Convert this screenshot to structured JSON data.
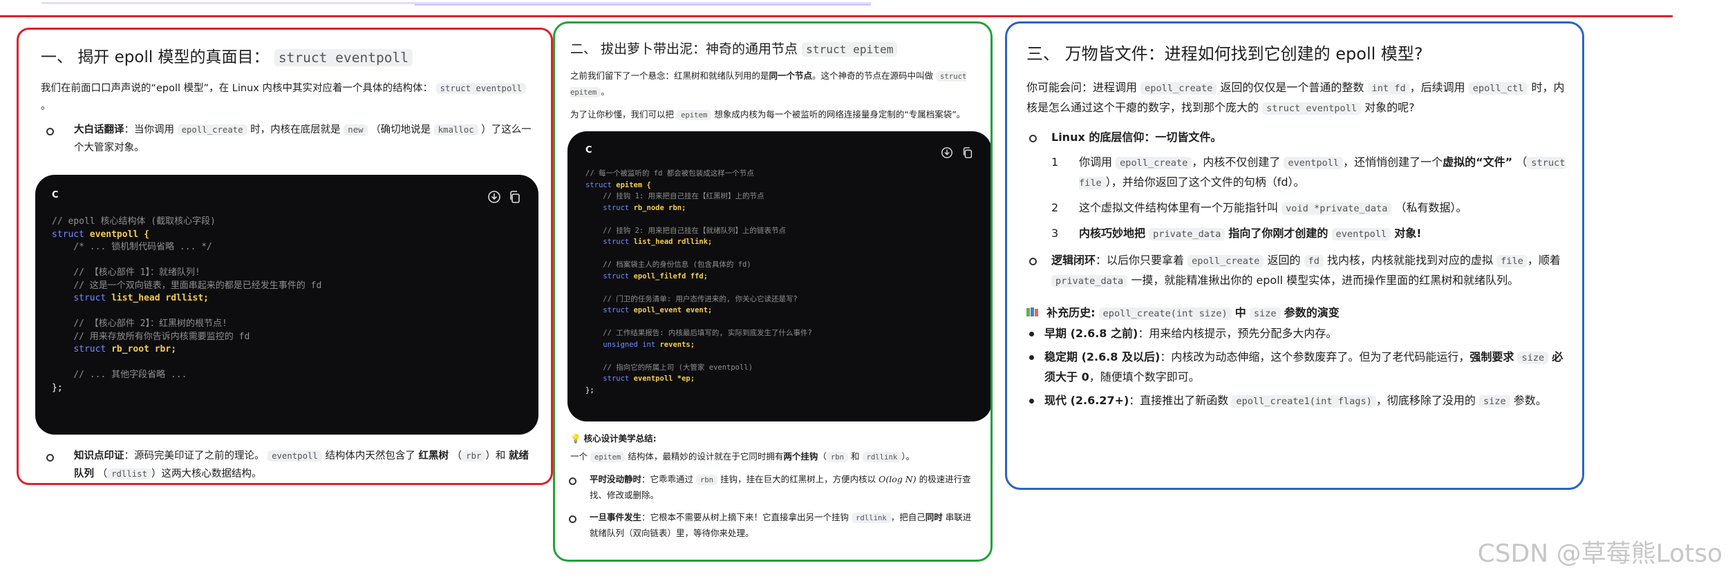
{
  "card1": {
    "title": "一、 揭开 epoll 模型的真面目：",
    "title_code": "struct eventpoll",
    "intro_a": "我们在前面口口声声说的“epoll 模型”，在 Linux 内核中其实对应着一个具体的结构体：",
    "intro_code": "struct eventpoll",
    "intro_b": "。",
    "bullet1_label": "大白话翻译",
    "bullet1_a": "：当你调用",
    "bullet1_code1": "epoll_create",
    "bullet1_b": "时，内核在底层就是",
    "bullet1_code2": "new",
    "bullet1_c": "（确切地说是",
    "bullet1_code3": "kmalloc",
    "bullet1_d": "）了这么一个大管家对象。",
    "code_lang": "C",
    "code_lines": [
      "// epoll 核心结构体 (截取核心字段)",
      "struct eventpoll {",
      "    /* ... 锁机制代码省略 ... */",
      "",
      "    // 【核心部件 1】：就绪队列!",
      "    // 这是一个双向链表，里面串起来的都是已经发生事件的 fd",
      "    struct list_head rdllist;",
      "",
      "    // 【核心部件 2】：红黑树的根节点!",
      "    // 用来存放所有你告诉内核需要监控的 fd",
      "    struct rb_root rbr;",
      "",
      "    // ... 其他字段省略 ...",
      "};"
    ],
    "bullet2_label": "知识点印证",
    "bullet2_a": "：源码完美印证了之前的理论。",
    "bullet2_code1": "eventpoll",
    "bullet2_b": "结构体内天然包含了",
    "bullet2_bold1": "红黑树",
    "bullet2_c": "（",
    "bullet2_code2": "rbr",
    "bullet2_d": "）和",
    "bullet2_bold2": "就绪队列",
    "bullet2_e": "（",
    "bullet2_code3": "rdllist",
    "bullet2_f": "）这两大核心数据结构。"
  },
  "card2": {
    "title": "二、 拔出萝卜带出泥：神奇的通用节点",
    "title_code": "struct epitem",
    "p1_a": "之前我们留下了一个悬念：红黑树和就绪队列用的是",
    "p1_bold": "同一个节点",
    "p1_b": "。这个神奇的节点在源码中叫做",
    "p1_code": "struct epitem",
    "p1_c": "。",
    "p2_a": "为了让你秒懂，我们可以把",
    "p2_code": "epitem",
    "p2_b": "想象成内核为每一个被监听的网络连接量身定制的“专属档案袋”。",
    "code_lang": "C",
    "code_lines": [
      "// 每一个被监听的 fd 都会被包装成这样一个节点",
      "struct epitem {",
      "    // 挂钩 1: 用来把自己挂在【红黑树】上的节点",
      "    struct rb_node rbn;",
      "",
      "    // 挂钩 2: 用来把自己挂在【就绪队列】上的链表节点",
      "    struct list_head rdllink;",
      "",
      "    // 档案袋主人的身份信息 (包含具体的 fd)",
      "    struct epoll_filefd ffd;",
      "",
      "    // 门卫的任务清单: 用户态传进来的, 你关心它读还是写?",
      "    struct epoll_event event;",
      "",
      "    // 工作结果报告: 内核最后填写的, 实际到底发生了什么事件?",
      "    unsigned int revents;",
      "",
      "    // 指向它的所属上司 (大管家 eventpoll)",
      "    struct eventpoll *ep;",
      "};"
    ],
    "summary_icon": "lightbulb-icon",
    "summary_title": "核心设计美学总结:",
    "summary_a": "一个",
    "summary_code1": "epitem",
    "summary_b": "结构体，最精妙的设计就在于它同时拥有",
    "summary_bold": "两个挂钩",
    "summary_c": "（",
    "summary_code2": "rbn",
    "summary_d": "和",
    "summary_code3": "rdllink",
    "summary_e": "）。",
    "b1_label": "平时没动静时",
    "b1_a": "：它乖乖通过",
    "b1_code": "rbn",
    "b1_b": "挂钩，挂在巨大的红黑树上，方便内核以",
    "b1_math": "O(log N)",
    "b1_c": "的极速进行查找、修改或删除。",
    "b2_label": "一旦事件发生",
    "b2_a": "：它根本不需要从树上摘下来！它直接拿出另一个挂钩",
    "b2_code": "rdllink",
    "b2_b": "，把自己",
    "b2_bold": "同时",
    "b2_c": "串联进就绪队列（双向链表）里，等待你来处理。"
  },
  "card3": {
    "title": "三、 万物皆文件：进程如何找到它创建的 epoll 模型?",
    "p1_a": "你可能会问：进程调用",
    "p1_code1": "epoll_create",
    "p1_b": "返回的仅仅是一个普通的整数",
    "p1_code2": "int fd",
    "p1_c": "，后续调用",
    "p1_code3": "epoll_ctl",
    "p1_d": "时，内核是怎么通过这个干瘪的数字，找到那个庞大的",
    "p1_code4": "struct eventpoll",
    "p1_e": "对象的呢?",
    "b1_label": "Linux 的底层信仰：一切皆文件。",
    "o1_n": "1",
    "o1_a": "你调用",
    "o1_code1": "epoll_create",
    "o1_b": "，内核不仅创建了",
    "o1_code2": "eventpoll",
    "o1_c": "，还悄悄创建了一个",
    "o1_bold": "虚拟的“文件”",
    "o1_d": "（",
    "o1_code3": "struct file",
    "o1_e": "），并给你返回了这个文件的句柄（fd）。",
    "o2_n": "2",
    "o2_a": "这个虚拟文件结构体里有一个万能指针叫",
    "o2_code": "void *private_data",
    "o2_b": "（私有数据）。",
    "o3_n": "3",
    "o3_bold1": "内核巧妙地把",
    "o3_code1": "private_data",
    "o3_bold2": "指向了你刚才创建的",
    "o3_code2": "eventpoll",
    "o3_bold3": "对象!",
    "b2_label": "逻辑闭环",
    "b2_a": "：以后你只要拿着",
    "b2_code1": "epoll_create",
    "b2_b": "返回的",
    "b2_code2": "fd",
    "b2_c": "找内核，内核就能找到对应的虚拟",
    "b2_code3": "file",
    "b2_d": "，顺着",
    "b2_code4": "private_data",
    "b2_e": "一摸，就能精准揪出你的 epoll 模型实体，进而操作里面的红黑树和就绪队列。",
    "hist_icon": "books-icon",
    "hist_a": "补充历史:",
    "hist_code1": "epoll_create(int size)",
    "hist_b": "中",
    "hist_code2": "size",
    "hist_c": "参数的演变",
    "h1_label": "早期 (2.6.8 之前)",
    "h1_text": "：用来给内核提示，预先分配多大内存。",
    "h2_label": "稳定期 (2.6.8 及以后)",
    "h2_a": "：内核改为动态伸缩，这个参数废弃了。但为了老代码能运行，",
    "h2_bold": "强制要求",
    "h2_code": "size",
    "h2_bold2": "必须大于 0",
    "h2_b": "，随便填个数字即可。",
    "h3_label": "现代 (2.6.27+)",
    "h3_a": "：直接推出了新函数",
    "h3_code1": "epoll_create1(int flags)",
    "h3_b": "，彻底移除了没用的",
    "h3_code2": "size",
    "h3_c": "参数。"
  },
  "watermark": "CSDN @草莓熊Lotso"
}
